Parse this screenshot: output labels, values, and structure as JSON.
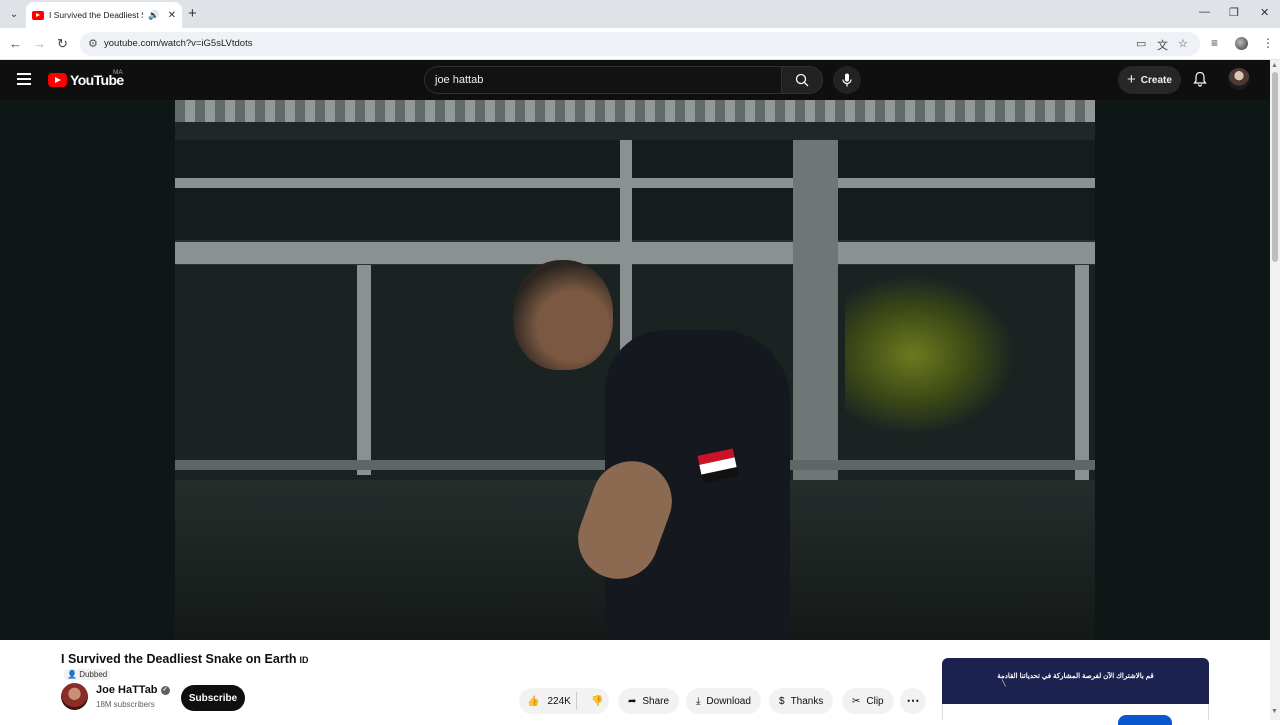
{
  "browser": {
    "tab_title": "I Survived the Deadliest Snake",
    "url": "youtube.com/watch?v=iG5sLVtdots"
  },
  "masthead": {
    "logo_text": "YouTube",
    "country_code": "MA",
    "search_value": "joe hattab",
    "create_label": "Create"
  },
  "video": {
    "title": "I Survived the Deadliest Snake on Earth",
    "title_badge": "ID",
    "dubbed_label": "Dubbed",
    "channel_name": "Joe HaTTab",
    "subscribers": "18M subscribers",
    "subscribe_label": "Subscribe",
    "actions": {
      "likes": "224K",
      "share": "Share",
      "download": "Download",
      "thanks": "Thanks",
      "clip": "Clip"
    }
  },
  "ad": {
    "headline": "قم بالاشتراك الآن لفرصة المشاركة في تحدياتنا القادمة"
  },
  "colors": {
    "brand_red": "#ff0000",
    "dark_bg": "#0f0f0f",
    "ad_bg": "#1c2250",
    "cta_blue": "#0b57d0"
  }
}
